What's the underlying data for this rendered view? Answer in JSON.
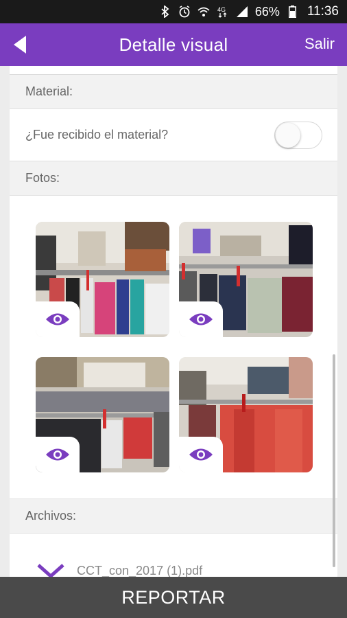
{
  "status_bar": {
    "battery_percent": "66%",
    "time": "11:36"
  },
  "app_bar": {
    "title": "Detalle visual",
    "exit_label": "Salir"
  },
  "material": {
    "header": "Material:",
    "question": "¿Fue recibido el material?",
    "received": false
  },
  "photos": {
    "header": "Fotos:",
    "count": 4
  },
  "files": {
    "header": "Archivos:",
    "first_file": "CCT_con_2017 (1).pdf"
  },
  "footer": {
    "report_label": "REPORTAR"
  },
  "colors": {
    "accent": "#7a3dbf",
    "footer": "#4a4a4a",
    "status_bar": "#1a1a1a"
  }
}
